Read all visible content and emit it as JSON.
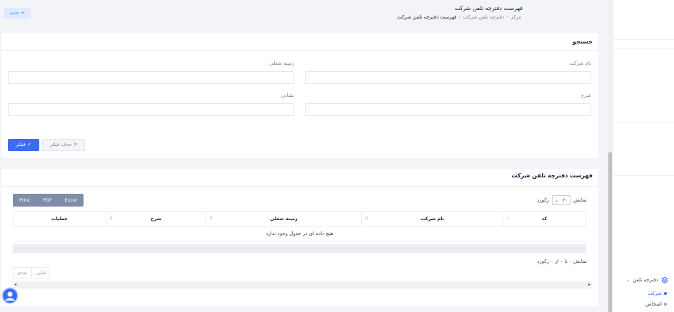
{
  "header": {
    "title": "فهرست دفترچه تلفن شرکت",
    "breadcrumb": [
      "مرکز",
      "دفترچه تلفن شرکت",
      "فهرست دفترچه تلفن شرکت"
    ],
    "new_button": "+ جدید"
  },
  "search": {
    "title": "جستجو",
    "fields": {
      "company_name": "نام شرکت",
      "business_field": "زمینه شغلی",
      "description": "شرح",
      "address": "نشانی"
    },
    "filter_button": "فیلتر",
    "clear_button": "حذف فیلتر"
  },
  "list": {
    "title": "فهرست دفترچه تلفن شرکت",
    "export_buttons": [
      "Print",
      "PDF",
      "Excel"
    ],
    "show_prefix": "نمایش",
    "page_size": "۲۰",
    "show_suffix": "رکورد",
    "columns": [
      "کد",
      "نام شرکت",
      "زمینه شغلی",
      "شرح",
      "عملیات"
    ],
    "empty_message": "هیچ داده ای در جدول وجود ندارد",
    "info": "نمایش ۰ تا ۰ از ۰ رکورد",
    "pager": {
      "previous": "قبلی",
      "next": "بعدی"
    }
  },
  "sidebar": {
    "parent": "دفترچه تلفن",
    "children": [
      "شرکت",
      "اشخاص"
    ]
  },
  "colors": {
    "primary": "#3b6df0",
    "export_bg": "#7e8ea8"
  }
}
